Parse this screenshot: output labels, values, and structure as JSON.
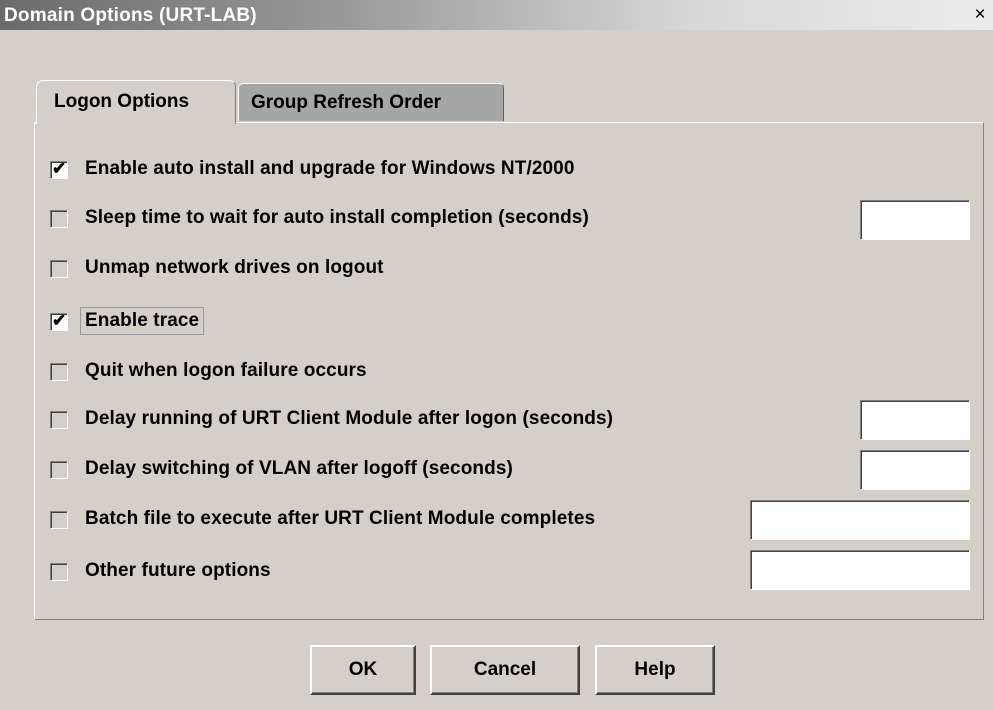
{
  "window": {
    "title": "Domain Options (URT-LAB)",
    "close_label": "×"
  },
  "tabs": [
    {
      "label": "Logon Options",
      "active": true
    },
    {
      "label": "Group Refresh Order",
      "active": false
    }
  ],
  "options": [
    {
      "label": "Enable auto install and upgrade for Windows NT/2000",
      "checked": true,
      "has_field": false,
      "value": ""
    },
    {
      "label": "Sleep time to wait for auto install completion (seconds)",
      "checked": false,
      "has_field": true,
      "value": ""
    },
    {
      "label": "Unmap network drives on logout",
      "checked": false,
      "has_field": false,
      "value": ""
    },
    {
      "label": "Enable trace",
      "checked": true,
      "has_field": false,
      "value": "",
      "focused": true
    },
    {
      "label": "Quit when logon failure occurs",
      "checked": false,
      "has_field": false,
      "value": ""
    },
    {
      "label": "Delay running of URT Client Module after logon (seconds)",
      "checked": false,
      "has_field": true,
      "value": ""
    },
    {
      "label": "Delay switching of VLAN after logoff (seconds)",
      "checked": false,
      "has_field": true,
      "value": ""
    },
    {
      "label": "Batch file to execute after URT Client Module completes",
      "checked": false,
      "has_field": true,
      "value": ""
    },
    {
      "label": "Other future options",
      "checked": false,
      "has_field": true,
      "value": ""
    }
  ],
  "buttons": {
    "ok": "OK",
    "cancel": "Cancel",
    "help": "Help"
  },
  "checkmark_glyph": "✔"
}
